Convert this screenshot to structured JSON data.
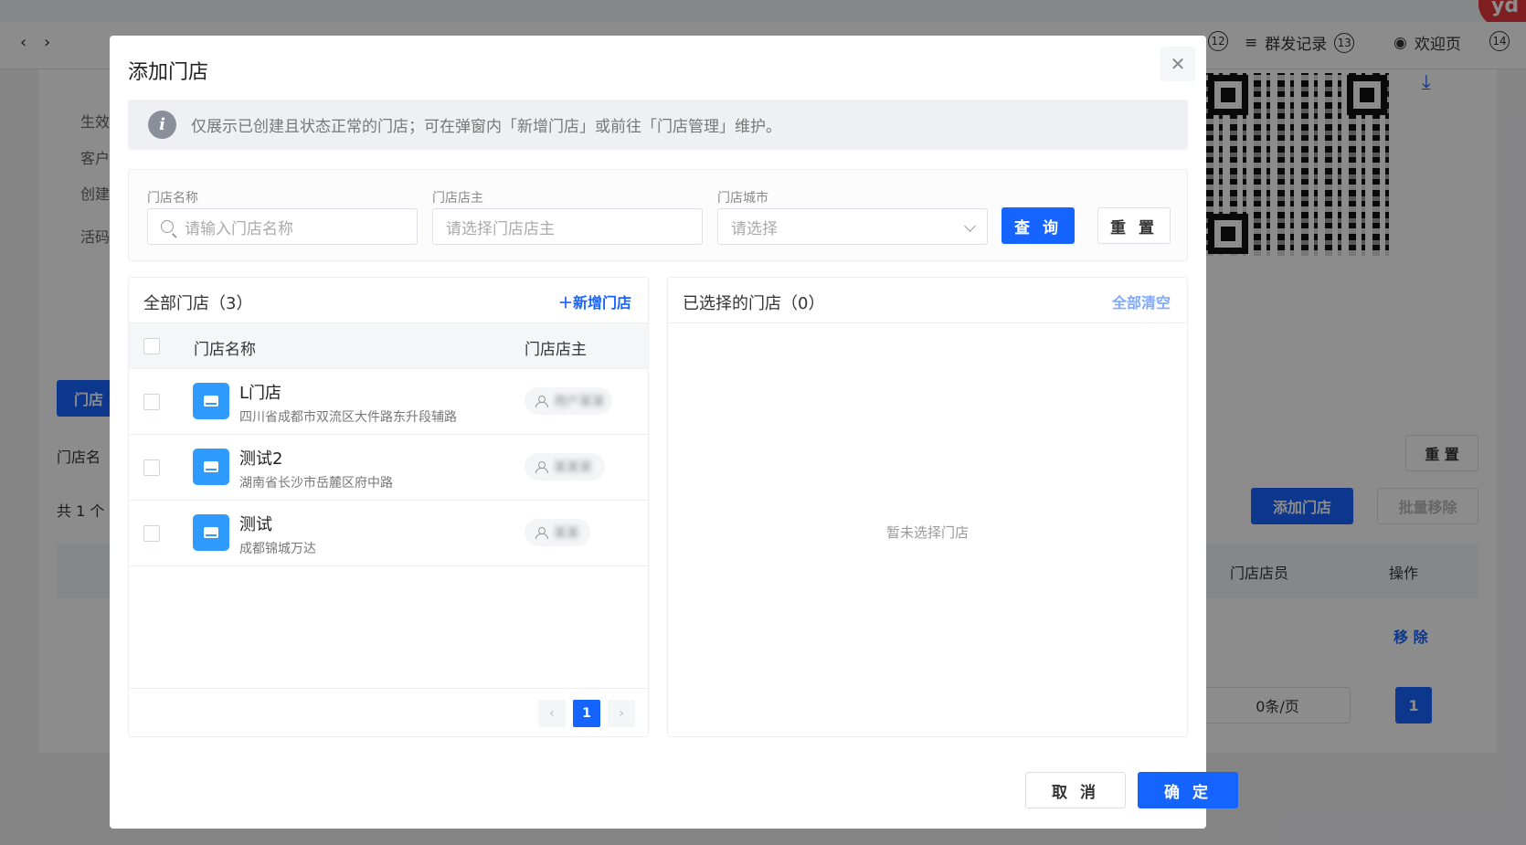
{
  "background": {
    "tab_right_1": "群发记录",
    "tab_right_1_num": "13",
    "tab_right_2": "欢迎页",
    "tab_right_2_num": "14",
    "tab_right_0_num": "12",
    "left_labels": [
      "活码",
      "生效",
      "客户",
      "创建",
      "活码"
    ],
    "store_tab_btn": "门店",
    "store_name_label": "门店名",
    "total_text": "共 1 个",
    "reset_label": "重 置",
    "add_store_label": "添加门店",
    "batch_remove_label": "批量移除",
    "col_staff": "门店店员",
    "col_action": "操作",
    "remove_label": "移 除",
    "page_size": "0条/页",
    "page_num": "1",
    "avatar_text": "yd"
  },
  "modal": {
    "title": "添加门店",
    "notice": "仅展示已创建且状态正常的门店；可在弹窗内「新增门店」或前往「门店管理」维护。",
    "filters": {
      "name_label": "门店名称",
      "name_placeholder": "请输入门店名称",
      "owner_label": "门店店主",
      "owner_placeholder": "请选择门店店主",
      "city_label": "门店城市",
      "city_placeholder": "请选择",
      "query_label": "查 询",
      "reset_label": "重 置"
    },
    "left_panel": {
      "title": "全部门店（3）",
      "add_action": "＋新增门店",
      "col_name": "门店名称",
      "col_owner": "门店店主",
      "rows": [
        {
          "name": "L门店",
          "address": "四川省成都市双流区大件路东升段辅路",
          "owner": "用户某某"
        },
        {
          "name": "测试2",
          "address": "湖南省长沙市岳麓区府中路",
          "owner": "某某某"
        },
        {
          "name": "测试",
          "address": "成都锦城万达",
          "owner": "某某"
        }
      ],
      "page": "1"
    },
    "right_panel": {
      "title": "已选择的门店（0）",
      "clear_action": "全部清空",
      "empty_text": "暂未选择门店"
    },
    "footer": {
      "cancel_label": "取 消",
      "ok_label": "确 定"
    }
  }
}
